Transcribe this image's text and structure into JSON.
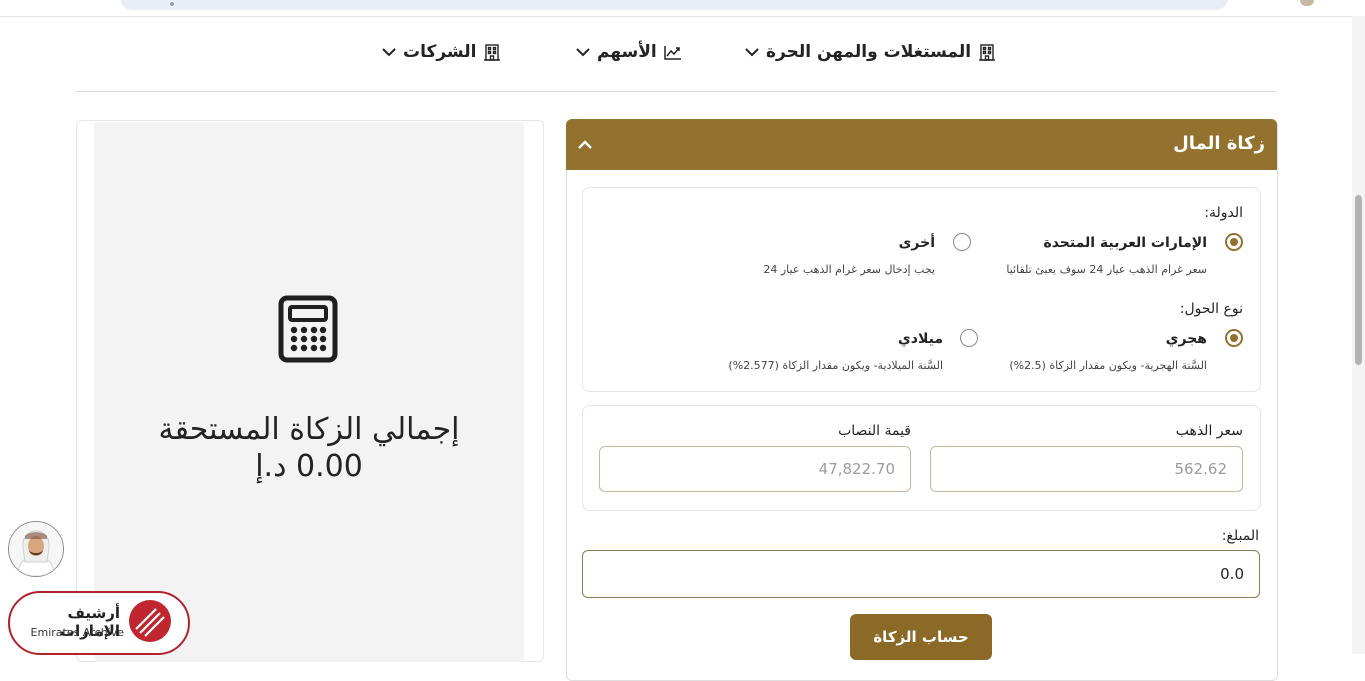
{
  "nav": {
    "items": [
      {
        "label": "المستغلات والمهن الحرة",
        "icon": "building-icon"
      },
      {
        "label": "الأسهم",
        "icon": "chart-line-icon"
      },
      {
        "label": "الشركات",
        "icon": "building-icon"
      }
    ]
  },
  "summary": {
    "icon": "calculator-icon",
    "title": "إجمالي الزكاة المستحقة",
    "total": "0.00 د.إ"
  },
  "logo": {
    "arabic": "أرشيف الإمارات",
    "english": "Emirates Archive"
  },
  "panel": {
    "title": "زكاة المال",
    "country": {
      "label": "الدولة:",
      "options": [
        {
          "title": "الإمارات العربية المتحدة",
          "desc": "سعر غرام الذهب عيار 24 سوف يعبئ تلقائيا",
          "selected": true
        },
        {
          "title": "أخرى",
          "desc": "يجب إدخال سعر غرام الذهب عيار 24",
          "selected": false
        }
      ]
    },
    "hawl": {
      "label": "نوع الحول:",
      "options": [
        {
          "title": "هجري",
          "desc": "السَّنة الهجرية- ويكون مقدار الزكاة (2.5%)",
          "selected": true
        },
        {
          "title": "ميلادي",
          "desc": "السَّنة الميلادية- ويكون مقدار الزكاة (2.577%)",
          "selected": false
        }
      ]
    },
    "gold_price": {
      "label": "سعر الذهب",
      "value": "562.62"
    },
    "nisab": {
      "label": "قيمة النصاب",
      "value": "47,822.70"
    },
    "amount": {
      "label": "المبلغ:",
      "value": "0.0"
    },
    "submit_label": "حساب الزكاة"
  },
  "colors": {
    "accent": "#92722e",
    "button": "#8a6a26",
    "logo_red": "#b0232b"
  }
}
